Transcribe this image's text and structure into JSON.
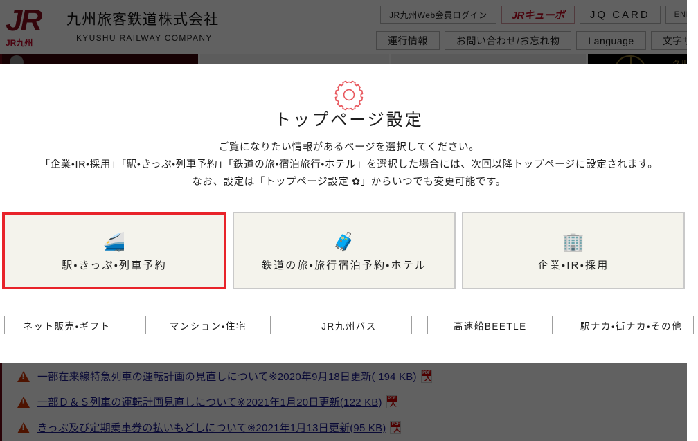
{
  "header": {
    "logo": {
      "mark": "JR",
      "mark_sub": "JR九州",
      "company_jp": "九州旅客鉄道株式会社",
      "company_en": "KYUSHU RAILWAY COMPANY"
    },
    "buttons_row1": [
      {
        "label": "JR九州Web会員ログイン",
        "style": "plain"
      },
      {
        "label": "JRキューポ",
        "style": "cube"
      },
      {
        "label": "JQ CARD",
        "style": "jqcard"
      },
      {
        "label": "ENHANCED",
        "style": "enhanced"
      }
    ],
    "buttons_row2": [
      {
        "label": "運行情報"
      },
      {
        "label": "お問い合わせ/お忘れ物"
      },
      {
        "label": "Language"
      },
      {
        "label": "文字サイズ"
      }
    ]
  },
  "background_strip": {
    "cruise_label": "クルー"
  },
  "modal": {
    "gear_icon": "gear-icon",
    "title": "トップページ設定",
    "description_lines": [
      "ご覧になりたい情報があるページを選択してください。",
      "「企業・IR・採用」「駅・きっぷ・列車予約」「鉄道の旅・宿泊旅行・ホテル」を選択した場合には、次回以降トップページに設定されます。",
      "なお、設定は「トップページ設定 ✿」からいつでも変更可能です。"
    ],
    "cards": [
      {
        "label": "駅・きっぷ・列車予約",
        "icon": "🚄",
        "icon_name": "bullet-train-icon",
        "selected": true
      },
      {
        "label": "鉄道の旅・旅行宿泊予約・ホテル",
        "icon": "🧳",
        "icon_name": "luggage-camera-icon",
        "selected": false
      },
      {
        "label": "企業・IR・採用",
        "icon": "🏢",
        "icon_name": "office-building-icon",
        "selected": false
      }
    ],
    "sub_buttons": [
      {
        "label": "ネット販売・ギフト"
      },
      {
        "label": "マンション・住宅"
      },
      {
        "label": "JR九州バス"
      },
      {
        "label": "高速船BEETLE"
      },
      {
        "label": "駅ナカ・街ナカ・その他"
      }
    ]
  },
  "notices": [
    {
      "icon": "warning-icon",
      "text": "一部在来線特急列車の運転計画の見直しについて※2020年9月18日更新( 194 KB)",
      "badge": "PDF"
    },
    {
      "icon": "warning-icon",
      "text": "一部Ｄ＆Ｓ列車の運転計画見直しについて※2021年1月20日更新(122 KB)",
      "badge": "PDF"
    },
    {
      "icon": "warning-icon",
      "text": "きっぷ及び定期乗車券の払いもどしについて※2021年1月13日更新(95 KB)",
      "badge": "PDF"
    }
  ],
  "colors": {
    "brand_red": "#c3092a",
    "selected_border": "#e8232a",
    "card_bg": "#f4f3ec",
    "gear_red": "#e8565c",
    "link_blue": "#1b1b8f",
    "warning_orange": "#cc3300"
  }
}
